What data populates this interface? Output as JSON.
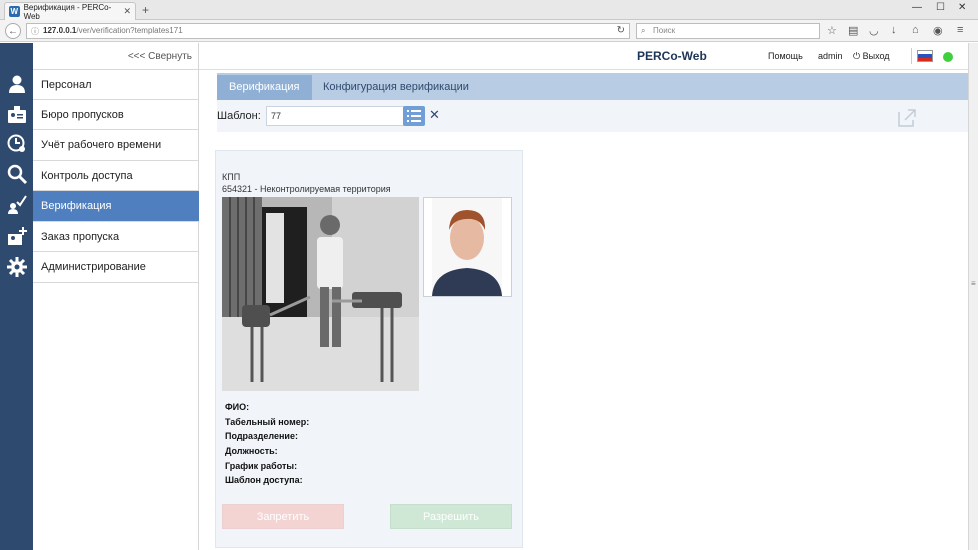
{
  "browser": {
    "tab_title": "Верификация - PERCo-Web",
    "url_host": "127.0.0.1",
    "url_path": "/ver/verification?templates171",
    "search_placeholder": "Поиск"
  },
  "sidebar": {
    "collapse_label": "<<< Свернуть",
    "items": [
      {
        "label": "Персонал",
        "icon": "person-icon"
      },
      {
        "label": "Бюро пропусков",
        "icon": "id-card-icon"
      },
      {
        "label": "Учёт рабочего времени",
        "icon": "clock-person-icon"
      },
      {
        "label": "Контроль доступа",
        "icon": "search-icon"
      },
      {
        "label": "Верификация",
        "icon": "verify-check-icon",
        "active": true
      },
      {
        "label": "Заказ пропуска",
        "icon": "pass-order-icon"
      },
      {
        "label": "Администрирование",
        "icon": "gear-icon"
      }
    ]
  },
  "header": {
    "brand": "PERCo-Web",
    "help": "Помощь",
    "user": "admin",
    "logout": "Выход",
    "status_color": "#3fcf3f"
  },
  "tabs": [
    {
      "label": "Верификация",
      "active": true
    },
    {
      "label": "Конфигурация верификации",
      "active": false
    }
  ],
  "filter": {
    "label": "Шаблон:",
    "value": "77"
  },
  "card": {
    "title": "КПП",
    "subtitle": "654321 - Неконтролируемая территория",
    "fields": [
      "ФИО:",
      "Табельный номер:",
      "Подразделение:",
      "Должность:",
      "График работы:",
      "Шаблон доступа:"
    ],
    "deny_label": "Запретить",
    "allow_label": "Разрешить"
  },
  "colors": {
    "rail": "#2f4a6f",
    "menu_active": "#4f7fbf",
    "tabs_bg": "#b8cde3",
    "deny": "#f4d3d3",
    "allow": "#cfe8d5"
  }
}
